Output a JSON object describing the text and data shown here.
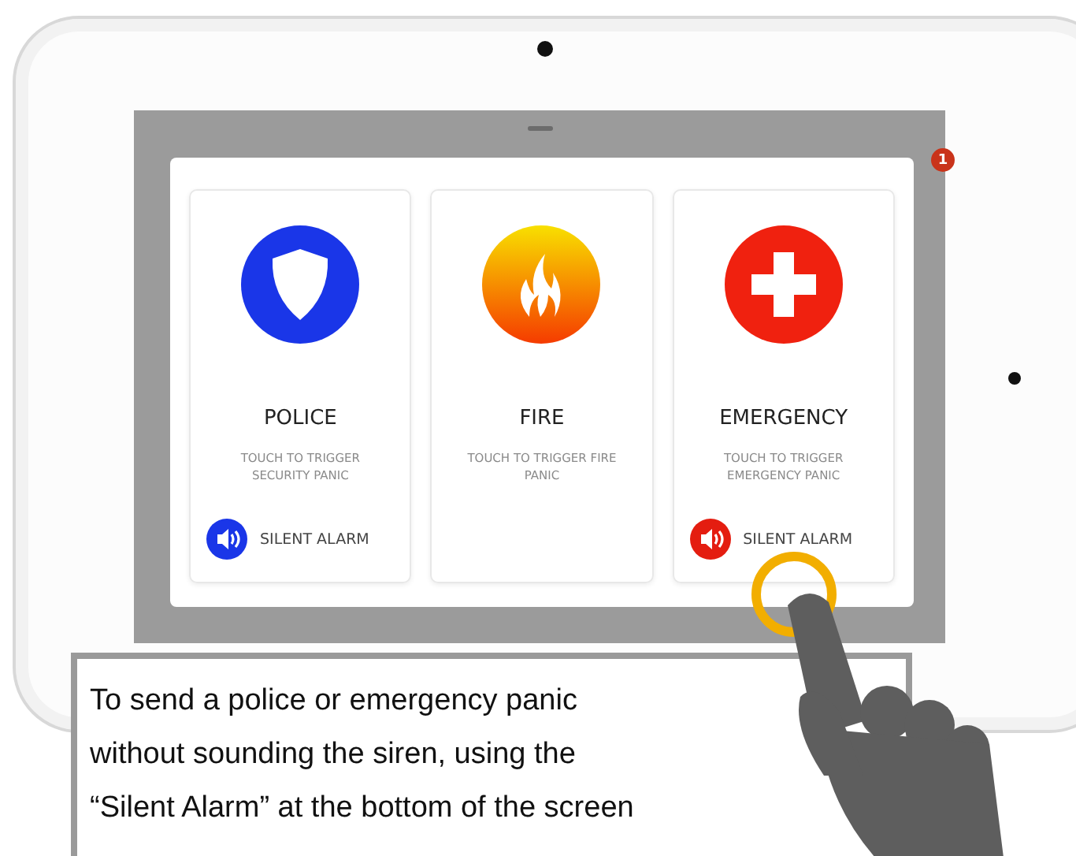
{
  "screen": {
    "notification_count": "1"
  },
  "panic_options": [
    {
      "kind": "police",
      "title": "POLICE",
      "description": "TOUCH TO TRIGGER SECURITY PANIC",
      "silent_alarm": "SILENT ALARM"
    },
    {
      "kind": "fire",
      "title": "FIRE",
      "description": "TOUCH TO TRIGGER FIRE PANIC"
    },
    {
      "kind": "emergency",
      "title": "EMERGENCY",
      "description": "TOUCH TO TRIGGER EMERGENCY PANIC",
      "silent_alarm": "SILENT ALARM"
    }
  ],
  "caption": "To send a police or emergency panic\nwithout sounding the siren, using the\n“Silent Alarm” at the bottom of the screen"
}
